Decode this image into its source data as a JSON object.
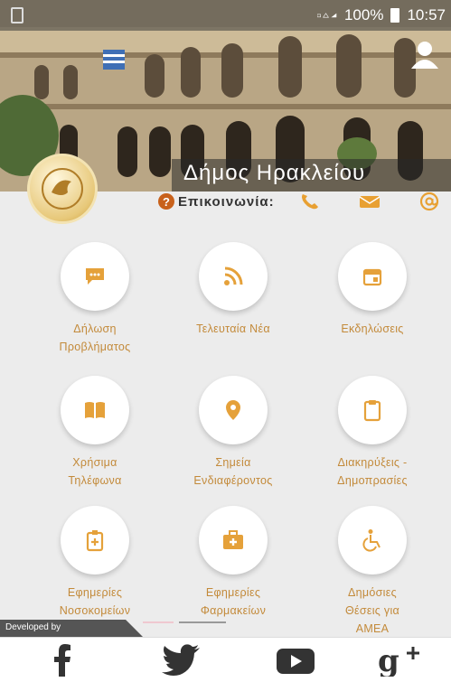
{
  "status_bar": {
    "battery": "100%",
    "time": "10:57"
  },
  "header": {
    "title": "Δήμος Ηρακλείου"
  },
  "contact": {
    "label": "Επικοινωνία:"
  },
  "tiles": [
    {
      "line1": "Δήλωση",
      "line2": "Προβλήματος",
      "line3": "",
      "icon": "chat-icon"
    },
    {
      "line1": "Τελευταία Νέα",
      "line2": "",
      "line3": "",
      "icon": "rss-icon"
    },
    {
      "line1": "Εκδηλώσεις",
      "line2": "",
      "line3": "",
      "icon": "calendar-icon"
    },
    {
      "line1": "Χρήσιμα",
      "line2": "Τηλέφωνα",
      "line3": "",
      "icon": "book-icon"
    },
    {
      "line1": "Σημεία",
      "line2": "Ενδιαφέροντος",
      "line3": "",
      "icon": "map-pin-icon"
    },
    {
      "line1": "Διακηρύξεις -",
      "line2": "Δημοπρασίες",
      "line3": "",
      "icon": "clipboard-icon"
    },
    {
      "line1": "Εφημερίες",
      "line2": "Νοσοκομείων",
      "line3": "",
      "icon": "hospital-icon"
    },
    {
      "line1": "Εφημερίες",
      "line2": "Φαρμακείων",
      "line3": "",
      "icon": "first-aid-icon"
    },
    {
      "line1": "Δημόσιες",
      "line2": "Θέσεις για",
      "line3": "ΑΜΕΑ",
      "icon": "wheelchair-icon"
    }
  ],
  "footer": {
    "developed_by": "Developed by"
  },
  "colors": {
    "accent": "#e5a13a",
    "label": "#c38a3a",
    "contact": "#e8a032"
  }
}
